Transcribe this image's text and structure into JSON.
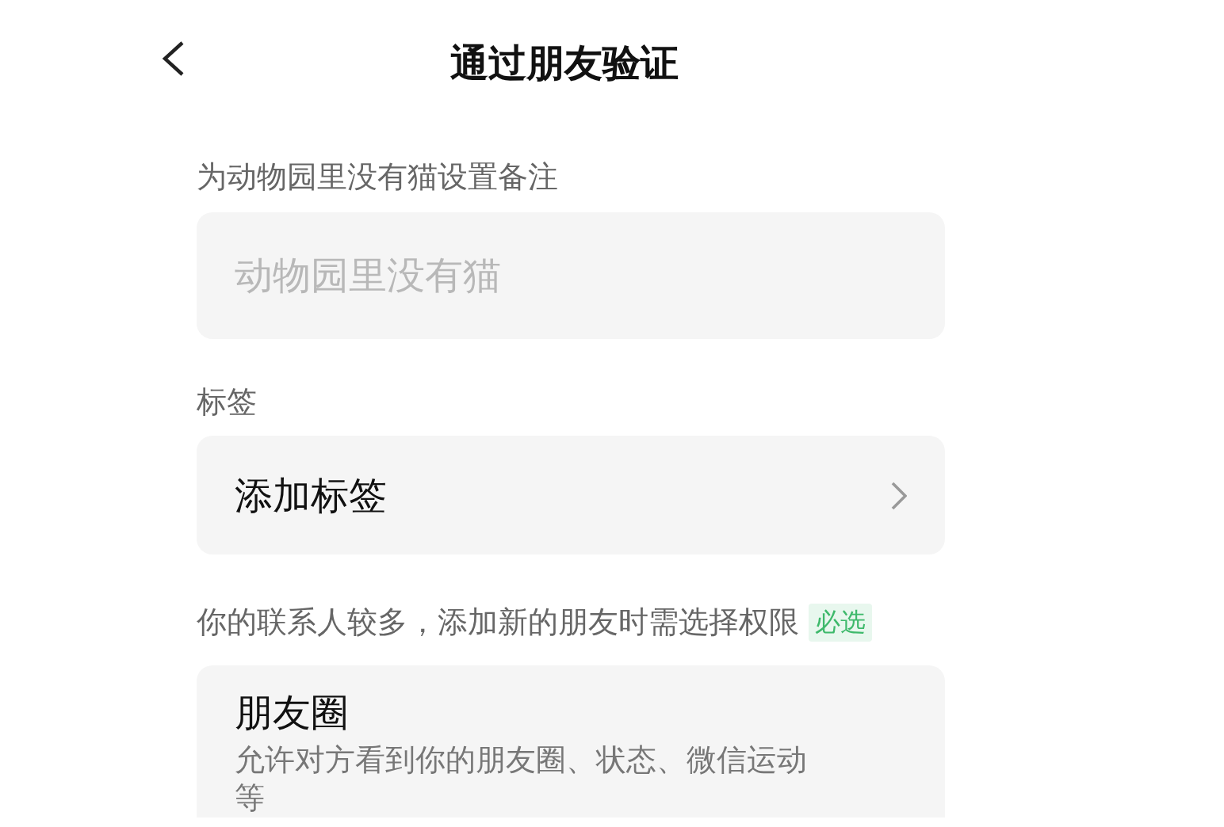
{
  "header": {
    "title": "通过朋友验证"
  },
  "remark": {
    "label": "为动物园里没有猫设置备注",
    "placeholder": "动物园里没有猫"
  },
  "tags": {
    "label": "标签",
    "row": "添加标签"
  },
  "permission": {
    "notice": "你的联系人较多，添加新的朋友时需选择权限",
    "badge": "必选",
    "options": [
      {
        "title": "朋友圈",
        "description": "允许对方看到你的朋友圈、状态、微信运动等"
      }
    ]
  }
}
